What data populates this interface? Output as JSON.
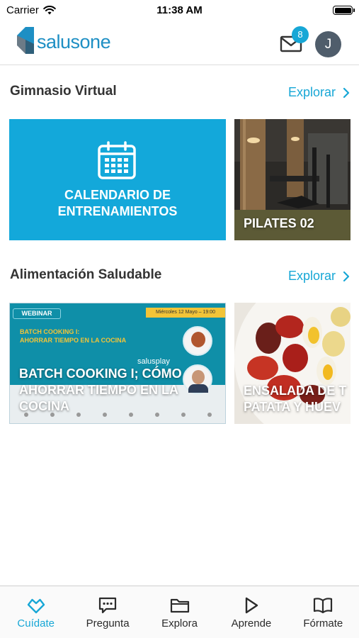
{
  "status_bar": {
    "carrier": "Carrier",
    "time": "11:38 AM"
  },
  "header": {
    "logo_text": "salusone",
    "mail_badge": "8",
    "avatar_initial": "J"
  },
  "sections": [
    {
      "title": "Gimnasio Virtual",
      "explore": "Explorar",
      "cards": [
        {
          "title": "CALENDARIO DE\nENTRENAMIENTOS"
        },
        {
          "title": "PILATES 02"
        }
      ]
    },
    {
      "title": "Alimentación Saludable",
      "explore": "Explorar",
      "cards": [
        {
          "title": "BATCH COOKING I; CÓMO AHORRAR TIEMPO EN LA COCINA",
          "webinar_tag": "WEBINAR",
          "date_banner": "Miércoles 12 Mayo – 19:00",
          "subtitle": "BATCH COOKING I:\nAHORRAR TIEMPO EN LA COCINA",
          "brand": "salusplay"
        },
        {
          "title": "ENSALADA DE T\nPATATA Y HUEV"
        }
      ]
    }
  ],
  "tabs": [
    {
      "label": "Cuídate",
      "icon": "heart-diamond-icon",
      "active": true
    },
    {
      "label": "Pregunta",
      "icon": "chat-bubble-icon",
      "active": false
    },
    {
      "label": "Explora",
      "icon": "folder-icon",
      "active": false
    },
    {
      "label": "Aprende",
      "icon": "play-icon",
      "active": false
    },
    {
      "label": "Fórmate",
      "icon": "book-icon",
      "active": false
    }
  ],
  "colors": {
    "accent": "#17a7d6",
    "calendar_card": "#13a8da",
    "avatar": "#4f5d6b"
  }
}
